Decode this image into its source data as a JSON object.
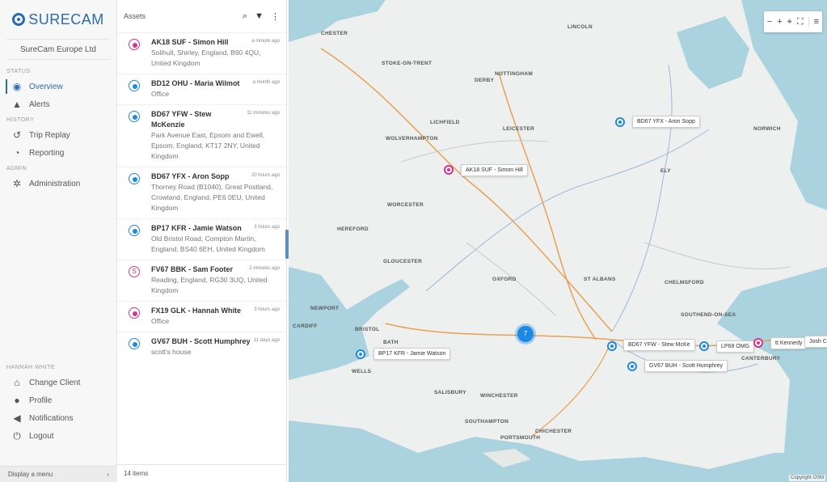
{
  "brand": {
    "name": "SURECAM",
    "color": "#2b6cb0"
  },
  "client": "SureCam Europe Ltd",
  "nav": {
    "status_label": "STATUS",
    "overview": "Overview",
    "alerts": "Alerts",
    "history_label": "HISTORY",
    "trip_replay": "Trip Replay",
    "reporting": "Reporting",
    "admin_label": "ADMIN",
    "administration": "Administration"
  },
  "user": {
    "name_label": "HANNAH WHITE",
    "change_client": "Change Client",
    "profile": "Profile",
    "notifications": "Notifications",
    "logout": "Logout"
  },
  "footer": {
    "display_menu": "Display a menu",
    "collapse_icon": "‹"
  },
  "assets_panel": {
    "title": "Assets",
    "count": "14 items",
    "items": [
      {
        "name": "AK18 SUF - Simon Hill",
        "time": "a minute ago",
        "address": "Solihull, Shirley, England, B90 4QU, United Kingdom",
        "status": "pink"
      },
      {
        "name": "BD12 OHU - Maria Wilmot",
        "time": "a month ago",
        "address": "Office",
        "status": "blue"
      },
      {
        "name": "BD67 YFW - Stew McKenzie",
        "time": "11 minutes ago",
        "address": "Park Avenue East, Epsom and Ewell, Epsom, England, KT17 2NY, United Kingdom",
        "status": "blue"
      },
      {
        "name": "BD67 YFX - Aron Sopp",
        "time": "20 hours ago",
        "address": "Thorney Road (B1040), Great Postland, Crowland, England, PE6 0EU, United Kingdom",
        "status": "blue"
      },
      {
        "name": "BP17 KFR - Jamie Watson",
        "time": "3 hours ago",
        "address": "Old Bristol Road, Compton Martin, England, BS40 6EH, United Kingdom",
        "status": "blue"
      },
      {
        "name": "FV67 BBK - Sam Footer",
        "time": "2 minutes ago",
        "address": "Reading, England, RG30 3UQ, United Kingdom",
        "status": "letter",
        "letter": "S"
      },
      {
        "name": "FX19 GLK - Hannah White",
        "time": "3 hours ago",
        "address": "Office",
        "status": "pink"
      },
      {
        "name": "GV67 BUH - Scott Humphrey",
        "time": "11 days ago",
        "address": "scott's house",
        "status": "blue"
      }
    ]
  },
  "map": {
    "cities": [
      "CHESTER",
      "LINCOLN",
      "STOKE-ON-TRENT",
      "DERBY",
      "NOTTINGHAM",
      "LICHFIELD",
      "LEICESTER",
      "NORWICH",
      "WOLVERHAMPTON",
      "ELY",
      "WORCESTER",
      "HEREFORD",
      "GLOUCESTER",
      "OXFORD",
      "ST ALBANS",
      "CHELMSFORD",
      "NEWPORT",
      "CARDIFF",
      "BRISTOL",
      "BATH",
      "WELLS",
      "SOUTHEND-ON-SEA",
      "SALISBURY",
      "WINCHESTER",
      "SOUTHAMPTON",
      "CHICHESTER",
      "PORTSMOUTH",
      "CANTERBURY"
    ],
    "markers": [
      {
        "label": "BD67 YFX - Aron Sopp",
        "color": "blue"
      },
      {
        "label": "AK18 SUF - Simon Hill",
        "color": "pink"
      },
      {
        "label": "BP17 KFR - Jamie Watson",
        "color": "blue"
      },
      {
        "label": "BD67 YFW - Stew McKe",
        "color": "blue"
      },
      {
        "label": "LP68 OMG",
        "color": "blue"
      },
      {
        "label": "tt Kennedy",
        "color": "pink"
      },
      {
        "label": "Josh C",
        "color": "blue"
      },
      {
        "label": "GV67 BUH - Scott Humphrey",
        "color": "blue"
      }
    ],
    "cluster_count": "7",
    "copyright": "Copyright OSM",
    "tools": {
      "zoom_out": "−",
      "zoom_in": "+",
      "locate": "⌖",
      "fullscreen": "⛶",
      "menu": "≡"
    }
  },
  "colors": {
    "marker_blue": "#1e88e5",
    "marker_pink": "#d6338f",
    "sea": "#aad3df",
    "land": "#eef0f0"
  }
}
